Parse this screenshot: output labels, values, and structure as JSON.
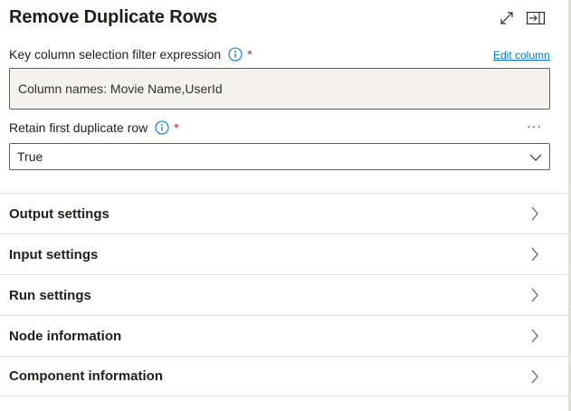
{
  "panel": {
    "title": "Remove Duplicate Rows",
    "header_icons": [
      "expand-icon",
      "dock-panel-icon"
    ]
  },
  "key_column": {
    "label": "Key column selection filter expression",
    "required_mark": "*",
    "edit_link": "Edit column",
    "value": "Column names: Movie Name,UserId"
  },
  "retain_first": {
    "label": "Retain first duplicate row",
    "required_mark": "*",
    "more_label": "···",
    "selected": "True"
  },
  "sections": [
    {
      "label": "Output settings"
    },
    {
      "label": "Input settings"
    },
    {
      "label": "Run settings"
    },
    {
      "label": "Node information"
    },
    {
      "label": "Component information"
    }
  ],
  "colors": {
    "link": "#0078d4",
    "required": "#a4262c",
    "divider": "#e1dfdd",
    "readonly_bg": "#f3f2f1"
  }
}
